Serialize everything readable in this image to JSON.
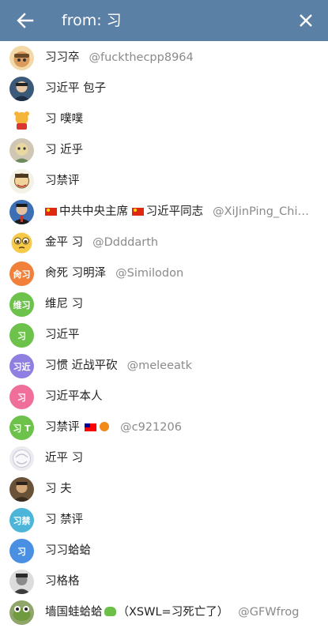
{
  "header": {
    "search_query": "from: 习",
    "colors": {
      "bar": "#5b80a6",
      "text": "#ffffff"
    }
  },
  "results": [
    {
      "name": "习习卒",
      "username": "@fuckthecpp8964",
      "avatar": "photo"
    },
    {
      "name": "习近平 包子",
      "username": "",
      "avatar": "photo"
    },
    {
      "name": "习 噗噗",
      "username": "",
      "avatar": "winnie-the-pooh-icon"
    },
    {
      "name": "习 近乎",
      "username": "",
      "avatar": "photo"
    },
    {
      "name": "习禁评",
      "username": "",
      "avatar": "cartoon"
    },
    {
      "name_prefix": "中共中央主席 ",
      "name_suffix": "习近平同志",
      "username": "@XiJinPing_Chi…",
      "avatar": "photo"
    },
    {
      "name": "金平 习",
      "username": "@Ddddarth",
      "avatar": "emoji-face-icon"
    },
    {
      "name": "肏死 习明泽",
      "username": "@Similodon",
      "avatar": "initials",
      "initials": "肏习",
      "color": "#f0803a"
    },
    {
      "name": "维尼 习",
      "username": "",
      "avatar": "initials",
      "initials": "维习",
      "color": "#6cc24a"
    },
    {
      "name": "习近平",
      "username": "",
      "avatar": "initials",
      "initials": "习",
      "color": "#6cc24a"
    },
    {
      "name": "习惯 近战平砍",
      "username": "@meleeatk",
      "avatar": "initials",
      "initials": "习近",
      "color": "#8e7fe0"
    },
    {
      "name": "习近平本人",
      "username": "",
      "avatar": "initials",
      "initials": "习",
      "color": "#ef6f9a"
    },
    {
      "name_prefix": "习禁评",
      "username": "@c921206",
      "avatar": "initials",
      "initials": "习 T",
      "color": "#6cc24a"
    },
    {
      "name": "近平 习",
      "username": "",
      "avatar": "photo"
    },
    {
      "name": "习 夫",
      "username": "",
      "avatar": "photo"
    },
    {
      "name": "习 禁评",
      "username": "",
      "avatar": "initials",
      "initials": "习禁",
      "color": "#4db6d8"
    },
    {
      "name": "习习蛤蛤",
      "username": "",
      "avatar": "initials",
      "initials": "习",
      "color": "#4a90e2"
    },
    {
      "name": "习格格",
      "username": "",
      "avatar": "photo"
    },
    {
      "name_prefix": "墙国蛙蛤蛤",
      "name_suffix": "（XSWL=习死亡了）",
      "username": "@GFWfrog",
      "avatar": "photo"
    }
  ]
}
